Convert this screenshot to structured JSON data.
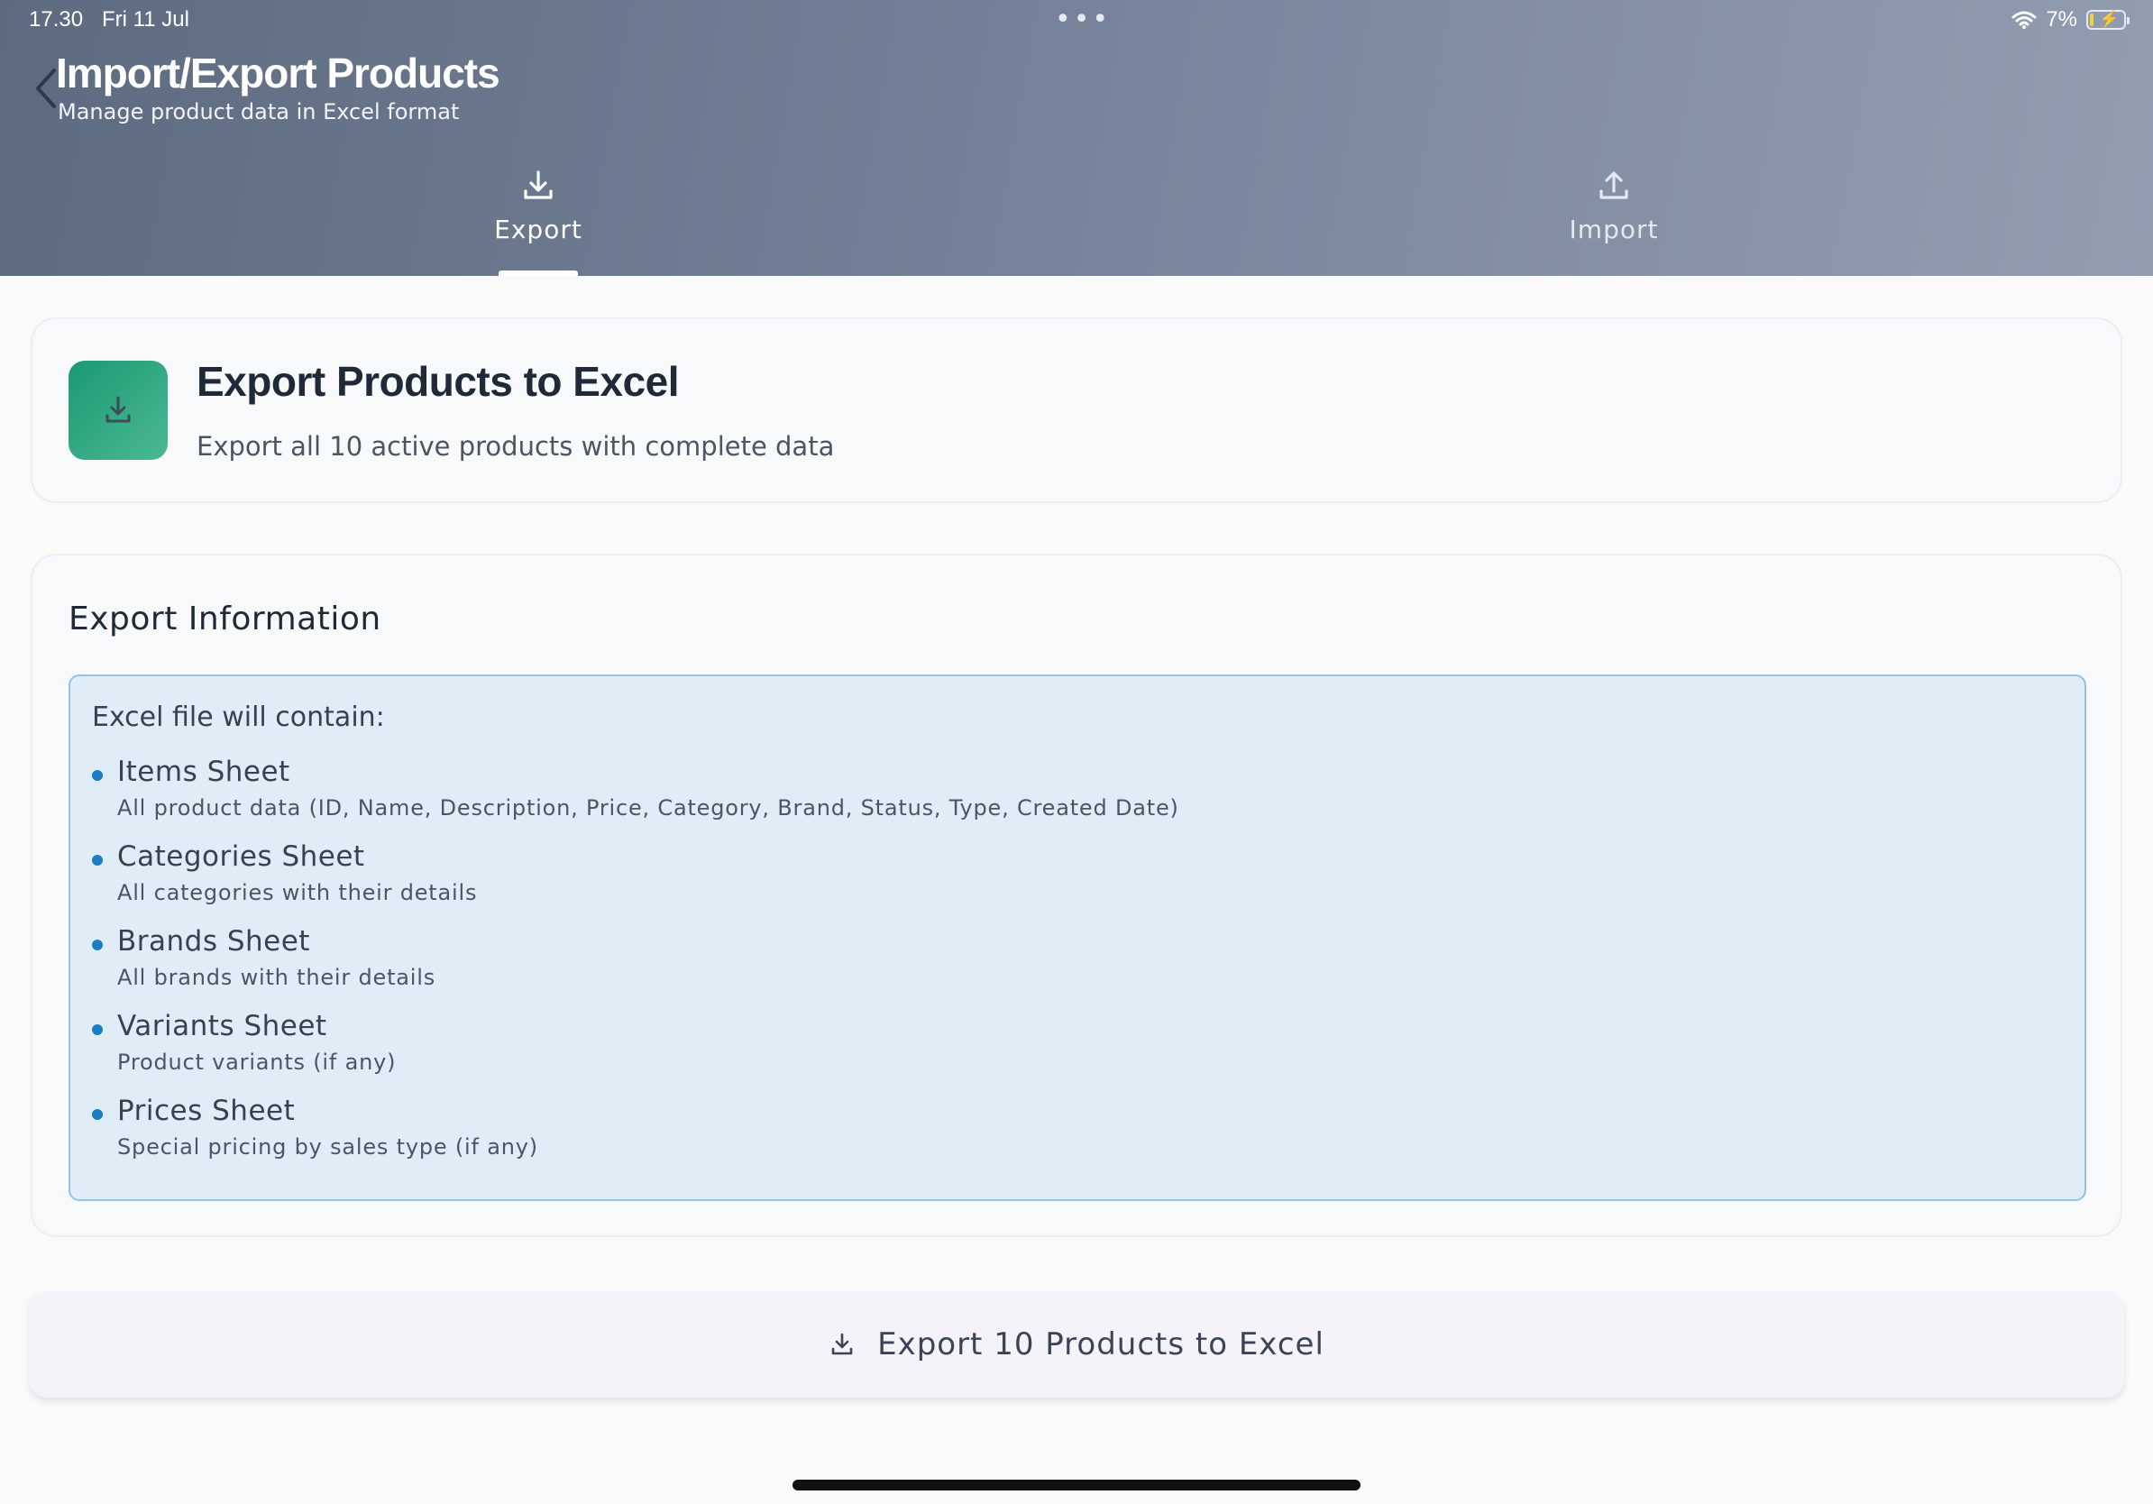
{
  "status_bar": {
    "time": "17.30",
    "date": "Fri 11 Jul",
    "dots": "•••",
    "battery_percent": "7%",
    "battery_level": 0.07
  },
  "header": {
    "title": "Import/Export Products",
    "subtitle": "Manage product data in Excel format"
  },
  "tabs": [
    {
      "label": "Export",
      "icon": "download-icon",
      "active": true
    },
    {
      "label": "Import",
      "icon": "upload-icon",
      "active": false
    }
  ],
  "export_card": {
    "icon": "download-icon",
    "title": "Export Products to Excel",
    "description": "Export all 10 active products with complete data"
  },
  "info_card": {
    "title": "Export Information",
    "box_title": "Excel file will contain:",
    "sheets": [
      {
        "name": "Items Sheet",
        "description": "All product data (ID, Name, Description, Price, Category, Brand, Status, Type, Created Date)"
      },
      {
        "name": "Categories Sheet",
        "description": "All categories with their details"
      },
      {
        "name": "Brands Sheet",
        "description": "All brands with their details"
      },
      {
        "name": "Variants Sheet",
        "description": "Product variants (if any)"
      },
      {
        "name": "Prices Sheet",
        "description": "Special pricing by sales type (if any)"
      }
    ]
  },
  "export_button": {
    "label": "Export 10 Products to Excel",
    "icon": "download-icon"
  },
  "colors": {
    "accent_green": "#1a9a73",
    "info_blue_bg": "#e0edf6",
    "info_blue_border": "#8fc4e4",
    "bullet_blue": "#1c7ec2"
  }
}
